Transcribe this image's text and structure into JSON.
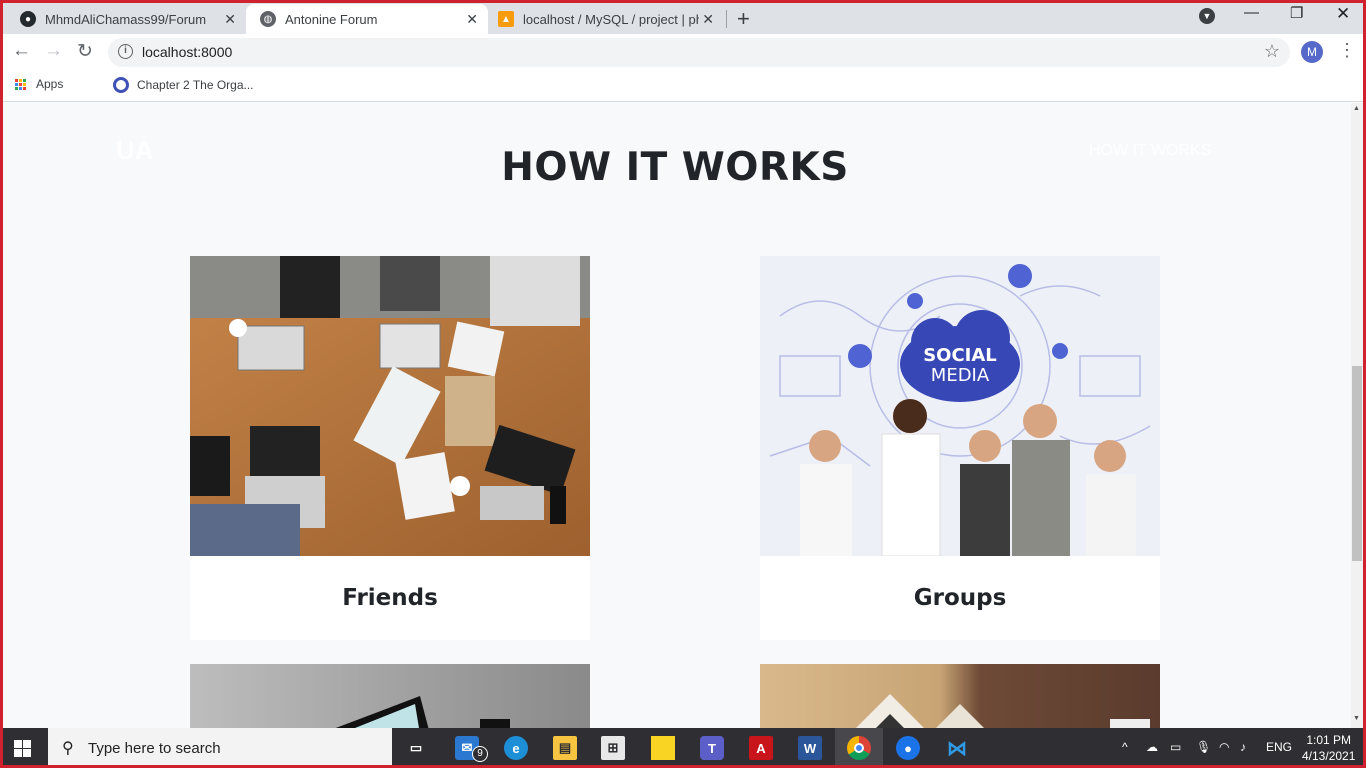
{
  "browser": {
    "tabs": [
      {
        "title": "MhmdAliChamass99/Forum",
        "active": false
      },
      {
        "title": "Antonine Forum",
        "active": true
      },
      {
        "title": "localhost / MySQL / project | php",
        "active": false
      }
    ],
    "url": "localhost:8000",
    "profile_initial": "M",
    "bookmarks": [
      {
        "label": "Apps"
      },
      {
        "label": "Chapter 2 The Orga..."
      }
    ]
  },
  "site": {
    "brand": "UA",
    "nav_link": "HOW IT WORKS",
    "section_title": "HOW IT WORKS",
    "cards": [
      {
        "caption": "Friends",
        "image": "team-meeting-photo"
      },
      {
        "caption": "Groups",
        "image": "social-media-photo"
      }
    ]
  },
  "taskbar": {
    "search_placeholder": "Type here to search",
    "mail_badge": "9",
    "language": "ENG",
    "time": "1:01 PM",
    "date": "4/13/2021"
  },
  "colors": {
    "accent_frame": "#d0212e",
    "tab_strip": "#dee1e6",
    "page_bg": "#f8f9fa",
    "title_text": "#212529",
    "taskbar": "#2f2f33"
  }
}
